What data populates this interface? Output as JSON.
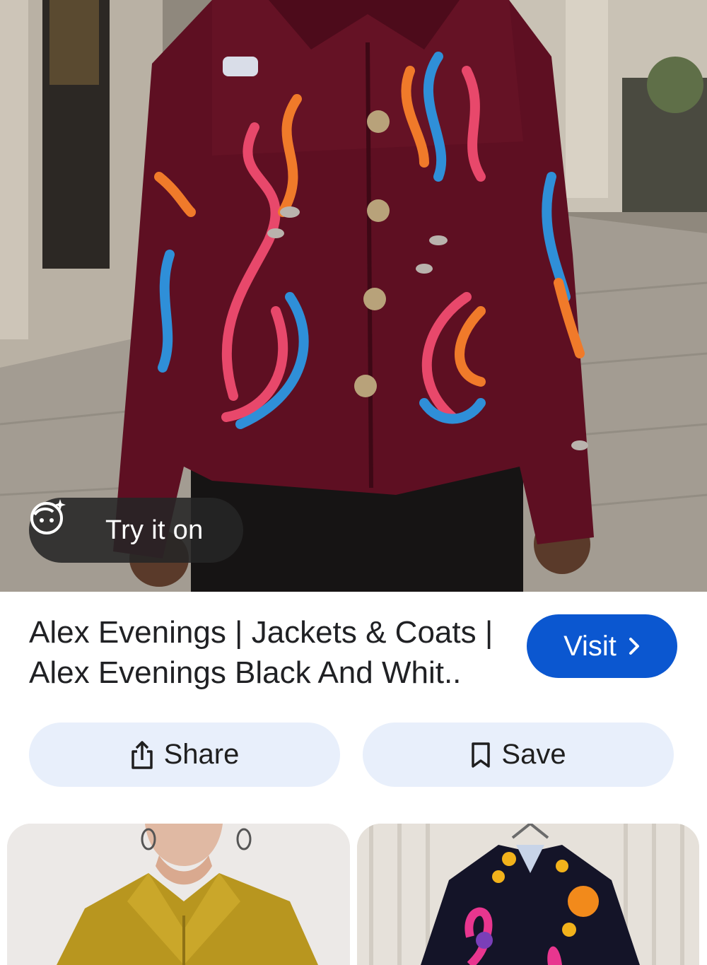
{
  "hero": {
    "image_icon": "jacket-photo",
    "try_on": {
      "label": "Try it on",
      "icon": "face-sparkle-icon"
    }
  },
  "result": {
    "title": "Alex Evenings | Jackets & Coats | Alex Evenings Black And Whit..",
    "visit_label": "Visit",
    "visit_icon": "chevron-right-icon",
    "accent_color": "#0b57d0"
  },
  "actions": {
    "share_label": "Share",
    "share_icon": "share-icon",
    "save_label": "Save",
    "save_icon": "bookmark-icon",
    "button_bg": "#e8effb"
  },
  "related": [
    {
      "icon": "yellow-corduroy-jacket-photo"
    },
    {
      "icon": "embroidered-black-jacket-photo"
    }
  ]
}
